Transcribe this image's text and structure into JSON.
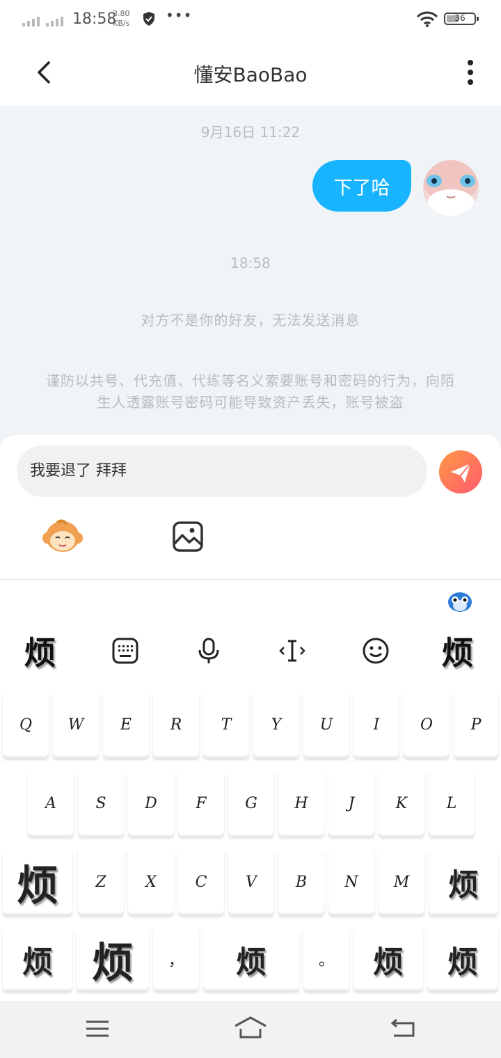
{
  "status_bar": {
    "time": "18:58",
    "speed_value": "3.80",
    "speed_unit": "KB/s",
    "dots": "•••",
    "battery": "36"
  },
  "header": {
    "title": "懂安BaoBao",
    "back_icon": "chevron-left-icon",
    "more_icon": "more-vertical-icon"
  },
  "chat": {
    "timestamp_1": "9月16日 11:22",
    "message_1": "下了哈",
    "timestamp_2": "18:58",
    "system_notice": "对方不是你的好友，无法发送消息",
    "security_notice": "谨防以共号、代充值、代练等名义索要账号和密码的行为，向陌生人透露账号密码可能导致资产丢失，账号被盗",
    "colors": {
      "bubble": "#19b4ff",
      "background": "#f1f4f6"
    }
  },
  "composer": {
    "input_value": "我要退了  拜拜",
    "send_icon": "paper-plane-icon",
    "emoji_icon": "monkey-face-icon",
    "image_icon": "image-icon"
  },
  "keyboard": {
    "toolbar": [
      {
        "name": "sticker-left",
        "label": "烦"
      },
      {
        "name": "keyboard-icon",
        "label": ""
      },
      {
        "name": "microphone-icon",
        "label": ""
      },
      {
        "name": "text-cursor-icon",
        "label": ""
      },
      {
        "name": "emoji-icon",
        "label": ""
      },
      {
        "name": "sticker-right",
        "label": "烦"
      }
    ],
    "row1": [
      "Q",
      "W",
      "E",
      "R",
      "T",
      "Y",
      "U",
      "I",
      "O",
      "P"
    ],
    "row2": [
      "A",
      "S",
      "D",
      "F",
      "G",
      "H",
      "J",
      "K",
      "L"
    ],
    "row3": [
      "烦",
      "Z",
      "X",
      "C",
      "V",
      "B",
      "N",
      "M",
      "烦"
    ],
    "row4": [
      "烦",
      "烦",
      "，",
      "烦",
      "。",
      "烦",
      "烦"
    ]
  },
  "nav_bar": {
    "menu_icon": "menu-icon",
    "home_icon": "home-icon",
    "back_icon": "back-icon"
  }
}
